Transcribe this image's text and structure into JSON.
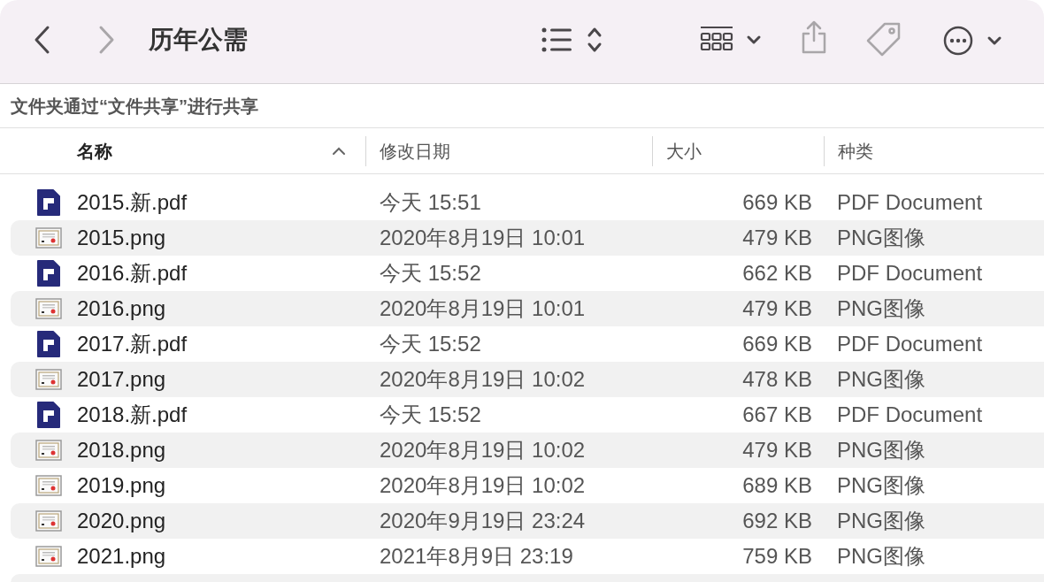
{
  "toolbar": {
    "title": "历年公需",
    "buttons": [
      {
        "kind": "back",
        "disabled": false
      },
      {
        "kind": "forward",
        "disabled": true
      },
      {
        "kind": "list-view",
        "disabled": false
      },
      {
        "kind": "group",
        "disabled": false
      },
      {
        "kind": "share",
        "disabled": true
      },
      {
        "kind": "tag",
        "disabled": true
      },
      {
        "kind": "more",
        "disabled": false
      }
    ]
  },
  "sharing_bar": {
    "text": "文件夹通过“文件共享”进行共享"
  },
  "table": {
    "columns": [
      {
        "label": "名称",
        "selected": true
      },
      {
        "label": "修改日期",
        "selected": false
      },
      {
        "label": "大小",
        "selected": false
      },
      {
        "label": "种类",
        "selected": false
      }
    ],
    "rows": [
      {
        "kind": "pdf",
        "name": "2015.新.pdf",
        "date": "今天 15:51",
        "size": "669 KB",
        "type": "PDF Document"
      },
      {
        "kind": "png",
        "name": "2015.png",
        "date": "2020年8月19日 10:01",
        "size": "479 KB",
        "type": "PNG图像"
      },
      {
        "kind": "pdf",
        "name": "2016.新.pdf",
        "date": "今天 15:52",
        "size": "662 KB",
        "type": "PDF Document"
      },
      {
        "kind": "png",
        "name": "2016.png",
        "date": "2020年8月19日 10:01",
        "size": "479 KB",
        "type": "PNG图像"
      },
      {
        "kind": "pdf",
        "name": "2017.新.pdf",
        "date": "今天 15:52",
        "size": "669 KB",
        "type": "PDF Document"
      },
      {
        "kind": "png",
        "name": "2017.png",
        "date": "2020年8月19日 10:02",
        "size": "478 KB",
        "type": "PNG图像"
      },
      {
        "kind": "pdf",
        "name": "2018.新.pdf",
        "date": "今天 15:52",
        "size": "667 KB",
        "type": "PDF Document"
      },
      {
        "kind": "png",
        "name": "2018.png",
        "date": "2020年8月19日 10:02",
        "size": "479 KB",
        "type": "PNG图像"
      },
      {
        "kind": "png",
        "name": "2019.png",
        "date": "2020年8月19日 10:02",
        "size": "689 KB",
        "type": "PNG图像"
      },
      {
        "kind": "png",
        "name": "2020.png",
        "date": "2020年9月19日 23:24",
        "size": "692 KB",
        "type": "PNG图像"
      },
      {
        "kind": "png",
        "name": "2021.png",
        "date": "2021年8月9日 23:19",
        "size": "759 KB",
        "type": "PNG图像"
      }
    ]
  }
}
